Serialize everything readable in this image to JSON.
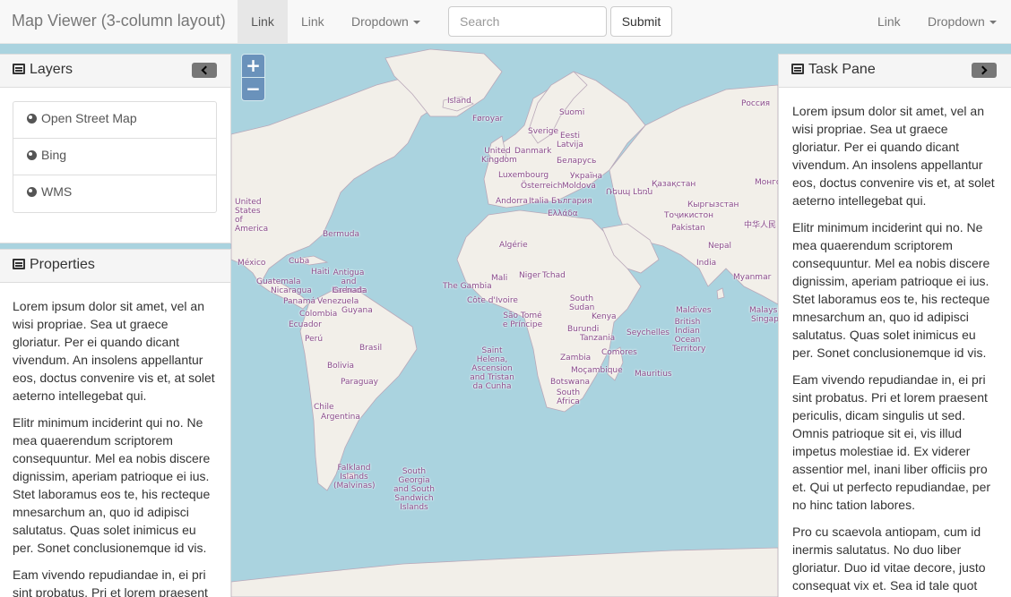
{
  "navbar": {
    "brand": "Map Viewer (3-column layout)",
    "left_links": [
      "Link",
      "Link"
    ],
    "left_dropdown": "Dropdown",
    "search_placeholder": "Search",
    "submit_label": "Submit",
    "right_link": "Link",
    "right_dropdown": "Dropdown"
  },
  "map": {
    "zoom_in": "+",
    "zoom_out": "−",
    "labels": [
      "Island",
      "Føroyar",
      "Suomi",
      "Sverige",
      "Eesti",
      "Latvija",
      "United Kingdom",
      "Danmark",
      "Беларусь",
      "Luxembourg",
      "Österreich",
      "Moldova",
      "Україна",
      "Қазақстан",
      "Andorra",
      "Italia",
      "България",
      "Ελλάδα",
      "Ռեսպ Լեռն",
      "United States of America",
      "Bermuda",
      "Algérie",
      "México",
      "Cuba",
      "Haiti",
      "Antigua and Barbuda",
      "Guatemala",
      "Nicaragua",
      "Grenada",
      "Panamá",
      "Venezuela",
      "Guyana",
      "Colombia",
      "Ecuador",
      "Perú",
      "Brasil",
      "Bolivia",
      "Paraguay",
      "Chile",
      "Argentina",
      "Falkland Islands (Malvinas)",
      "South Georgia and South Sandwich Islands",
      "Mali",
      "Niger",
      "Tchad",
      "The Gambia",
      "Côte d'Ivoire",
      "São Tomé e Príncipe",
      "South Sudan",
      "Kenya",
      "Burundi",
      "Tanzania",
      "Seychelles",
      "Comores",
      "Zambia",
      "Moçambique",
      "Botswana",
      "South Africa",
      "Mauritius",
      "Saint Helena, Ascension and Tristan da Cunha",
      "Maldives",
      "British Indian Ocean Territory",
      "Pakistan",
      "Nepal",
      "India",
      "Кыргызстан",
      "Тоҷикистон",
      "Россия",
      "Монгол",
      "中华人民",
      "Myanmar",
      "Malaysia",
      "Singapore"
    ]
  },
  "layers": {
    "title": "Layers",
    "items": [
      "Open Street Map",
      "Bing",
      "WMS"
    ]
  },
  "properties": {
    "title": "Properties",
    "paragraphs": [
      "Lorem ipsum dolor sit amet, vel an wisi propriae. Sea ut graece gloriatur. Per ei quando dicant vivendum. An insolens appellantur eos, doctus convenire vis et, at solet aeterno intellegebat qui.",
      "Elitr minimum inciderint qui no. Ne mea quaerendum scriptorem consequuntur. Mel ea nobis discere dignissim, aperiam patrioque ei ius. Stet laboramus eos te, his recteque mnesarchum an, quo id adipisci salutatus. Quas solet inimicus eu per. Sonet conclusionemque id vis.",
      "Eam vivendo repudiandae in, ei pri sint probatus. Pri et lorem praesent"
    ]
  },
  "task_pane": {
    "title": "Task Pane",
    "paragraphs": [
      "Lorem ipsum dolor sit amet, vel an wisi propriae. Sea ut graece gloriatur. Per ei quando dicant vivendum. An insolens appellantur eos, doctus convenire vis et, at solet aeterno intellegebat qui.",
      "Elitr minimum inciderint qui no. Ne mea quaerendum scriptorem consequuntur. Mel ea nobis discere dignissim, aperiam patrioque ei ius. Stet laboramus eos te, his recteque mnesarchum an, quo id adipisci salutatus. Quas solet inimicus eu per. Sonet conclusionemque id vis.",
      "Eam vivendo repudiandae in, ei pri sint probatus. Pri et lorem praesent periculis, dicam singulis ut sed. Omnis patrioque sit ei, vis illud impetus molestiae id. Ex viderer assentior mel, inani liber officiis pro et. Qui ut perfecto repudiandae, per no hinc tation labores.",
      "Pro cu scaevola antiopam, cum id inermis salutatus. No duo liber gloriatur. Duo id vitae decore, justo consequat vix et. Sea id tale quot"
    ]
  },
  "colors": {
    "ocean": "#aad3df",
    "land": "#f2efe9",
    "border": "#b9a8b9",
    "label": "#8a4a8a"
  }
}
